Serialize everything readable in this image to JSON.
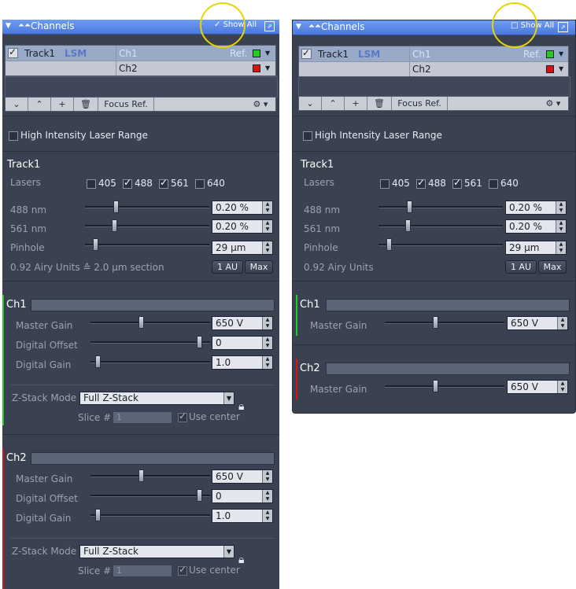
{
  "panel": {
    "title": "Channels",
    "show_all": "Show All",
    "track_name": "Track1",
    "track_type": "LSM",
    "ch1": "Ch1",
    "ch2": "Ch2",
    "ref": "Ref.",
    "focus_ref": "Focus Ref.",
    "high_intensity": "High Intensity Laser Range",
    "lasers_label": "Lasers",
    "lasers": [
      {
        "label": "405",
        "checked": false
      },
      {
        "label": "488",
        "checked": true
      },
      {
        "label": "561",
        "checked": true
      },
      {
        "label": "640",
        "checked": false
      }
    ],
    "nm488_label": "488 nm",
    "nm488_value": "0.20 %",
    "nm561_label": "561 nm",
    "nm561_value": "0.20 %",
    "pinhole_label": "Pinhole",
    "pinhole_value": "29 µm",
    "airy_text": "0.92 Airy Units ≙ 2.0 µm section",
    "airy_text_short": "0.92 Airy Units",
    "au_button": "1 AU",
    "max_button": "Max",
    "master_gain_label": "Master Gain",
    "master_gain_value": "650 V",
    "digital_offset_label": "Digital Offset",
    "digital_offset_value": "0",
    "digital_gain_label": "Digital Gain",
    "digital_gain_value": "1.0",
    "zstack_label": "Z-Stack Mode",
    "zstack_value": "Full Z-Stack",
    "slice_label": "Slice #",
    "slice_value": "1",
    "use_center": "Use center"
  },
  "colors": {
    "titlebar": "#5a88e8",
    "panel_bg": "#3a4252",
    "ch1_color": "#22cc22",
    "ch2_color": "#dd1111",
    "highlight_circle": "#e8d400"
  }
}
